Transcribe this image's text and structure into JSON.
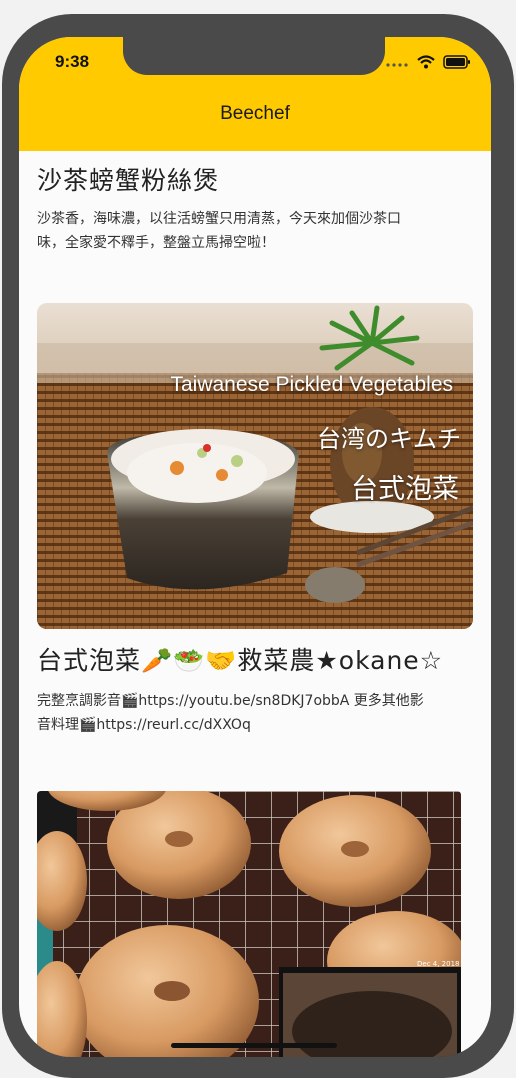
{
  "status_bar": {
    "time": "9:38"
  },
  "nav": {
    "title": "Beechef"
  },
  "recipes": [
    {
      "title": "沙茶螃蟹粉絲煲",
      "description_line1": "沙茶香，海味濃，以往活螃蟹只用清蒸，今天來加個沙茶口",
      "description_line2": "味，全家愛不釋手，整盤立馬掃空啦！"
    },
    {
      "image_caption_en": "Taiwanese Pickled Vegetables",
      "image_caption_jp": "台湾のキムチ",
      "image_caption_zh": "台式泡菜",
      "title": "台式泡菜🥕🥗🤝救菜農★okane☆",
      "description_line1": "完整烹調影音🎬https://youtu.be/sn8DKJ7obbA 更多其他影",
      "description_line2": "音料理🎬https://reurl.cc/dXXOq"
    },
    {
      "image_date_stamp": "Dec 4, 2018"
    }
  ],
  "colors": {
    "accent": "#ffca00",
    "frame": "#4a4a4a"
  }
}
